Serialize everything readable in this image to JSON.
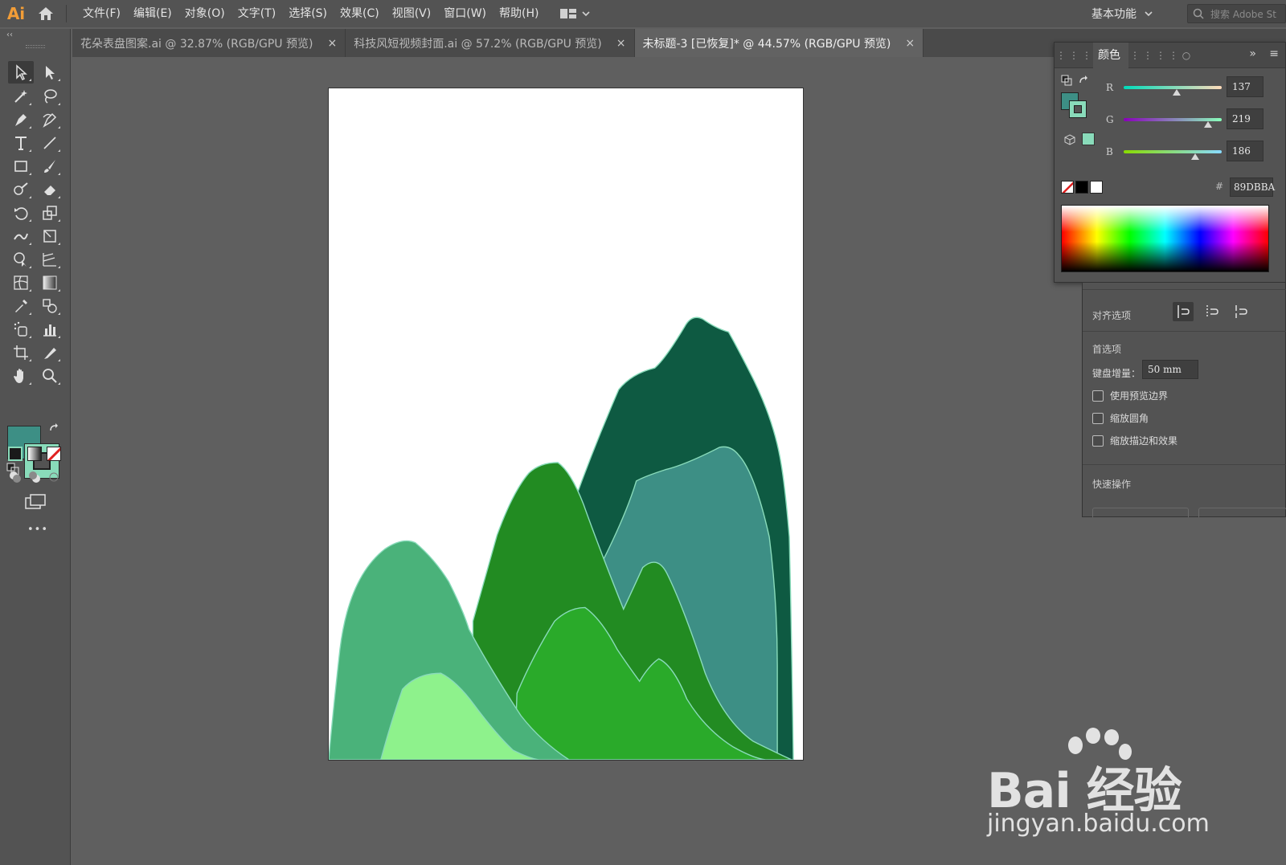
{
  "app": {
    "logo": "Ai"
  },
  "menu": [
    {
      "label": "文件(F)"
    },
    {
      "label": "编辑(E)"
    },
    {
      "label": "对象(O)"
    },
    {
      "label": "文字(T)"
    },
    {
      "label": "选择(S)"
    },
    {
      "label": "效果(C)"
    },
    {
      "label": "视图(V)"
    },
    {
      "label": "窗口(W)"
    },
    {
      "label": "帮助(H)"
    }
  ],
  "workspace": {
    "label": "基本功能"
  },
  "search": {
    "text": "搜索 Adobe St"
  },
  "tabs": [
    {
      "label": "花朵表盘图案.ai @ 32.87% (RGB/GPU 预览)",
      "close": "×",
      "active": false
    },
    {
      "label": "科技风短视频封面.ai @ 57.2% (RGB/GPU 预览)",
      "close": "×",
      "active": false
    },
    {
      "label": "未标题-3 [已恢复]* @ 44.57% (RGB/GPU 预览)",
      "close": "×",
      "active": true
    }
  ],
  "toolbar": {
    "more": "•••"
  },
  "colors": {
    "fill": "#3d8f85",
    "stroke": "#89dbba",
    "mountain_darkest": "#0e5a42",
    "mountain_teal": "#3d8f85",
    "mountain_green": "#228b22",
    "mountain_light_green": "#2aaa2a",
    "mountain_jade": "#4ab27a",
    "mountain_pale": "#8ef28c"
  },
  "color_panel": {
    "tab_label": "颜色",
    "more": "»",
    "sliders": [
      {
        "label": "R",
        "value": "137",
        "level": 0.537
      },
      {
        "label": "G",
        "value": "219",
        "level": 0.859
      },
      {
        "label": "B",
        "value": "186",
        "level": 0.729
      }
    ],
    "hex_hash": "#",
    "hex": "89DBBA"
  },
  "properties": {
    "align_options": "对齐选项",
    "preferences": "首选项",
    "keyboard_increment_label": "键盘增量：",
    "keyboard_increment_value": "50 mm",
    "checkboxes": [
      {
        "label": "使用预览边界",
        "checked": false
      },
      {
        "label": "缩放圆角",
        "checked": false
      },
      {
        "label": "缩放描边和效果",
        "checked": false
      }
    ],
    "quick_actions": "快速操作"
  },
  "watermark": {
    "brand": "Bai 经验",
    "url": "jingyan.baidu.com"
  }
}
